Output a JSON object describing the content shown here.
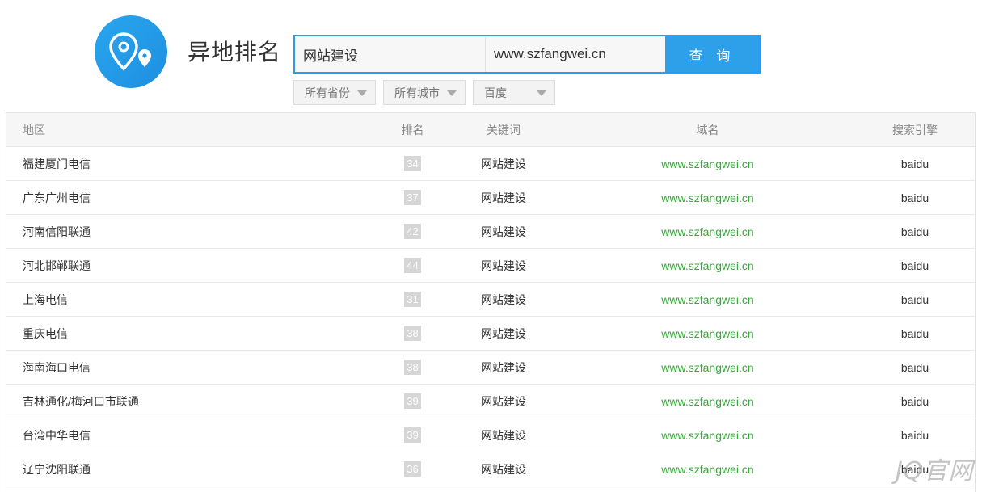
{
  "header": {
    "title": "异地排名",
    "logo_icon": "location-pin-icon"
  },
  "search": {
    "keyword_value": "网站建设",
    "domain_value": "www.szfangwei.cn",
    "button_label": "查 询"
  },
  "filters": {
    "province": "所有省份",
    "city": "所有城市",
    "engine": "百度"
  },
  "table": {
    "columns": {
      "region": "地区",
      "rank": "排名",
      "keyword": "关键词",
      "domain": "域名",
      "engine": "搜索引擎"
    },
    "rows": [
      {
        "region": "福建厦门电信",
        "rank": "34",
        "keyword": "网站建设",
        "domain": "www.szfangwei.cn",
        "engine": "baidu"
      },
      {
        "region": "广东广州电信",
        "rank": "37",
        "keyword": "网站建设",
        "domain": "www.szfangwei.cn",
        "engine": "baidu"
      },
      {
        "region": "河南信阳联通",
        "rank": "42",
        "keyword": "网站建设",
        "domain": "www.szfangwei.cn",
        "engine": "baidu"
      },
      {
        "region": "河北邯郸联通",
        "rank": "44",
        "keyword": "网站建设",
        "domain": "www.szfangwei.cn",
        "engine": "baidu"
      },
      {
        "region": "上海电信",
        "rank": "31",
        "keyword": "网站建设",
        "domain": "www.szfangwei.cn",
        "engine": "baidu"
      },
      {
        "region": "重庆电信",
        "rank": "38",
        "keyword": "网站建设",
        "domain": "www.szfangwei.cn",
        "engine": "baidu"
      },
      {
        "region": "海南海口电信",
        "rank": "38",
        "keyword": "网站建设",
        "domain": "www.szfangwei.cn",
        "engine": "baidu"
      },
      {
        "region": "吉林通化/梅河口市联通",
        "rank": "39",
        "keyword": "网站建设",
        "domain": "www.szfangwei.cn",
        "engine": "baidu"
      },
      {
        "region": "台湾中华电信",
        "rank": "39",
        "keyword": "网站建设",
        "domain": "www.szfangwei.cn",
        "engine": "baidu"
      },
      {
        "region": "辽宁沈阳联通",
        "rank": "36",
        "keyword": "网站建设",
        "domain": "www.szfangwei.cn",
        "engine": "baidu"
      }
    ]
  },
  "watermark": "JQ官网",
  "colors": {
    "accent": "#2e9fe9",
    "domain_link": "#37a83a",
    "rank_badge": "#d6d6d6"
  }
}
